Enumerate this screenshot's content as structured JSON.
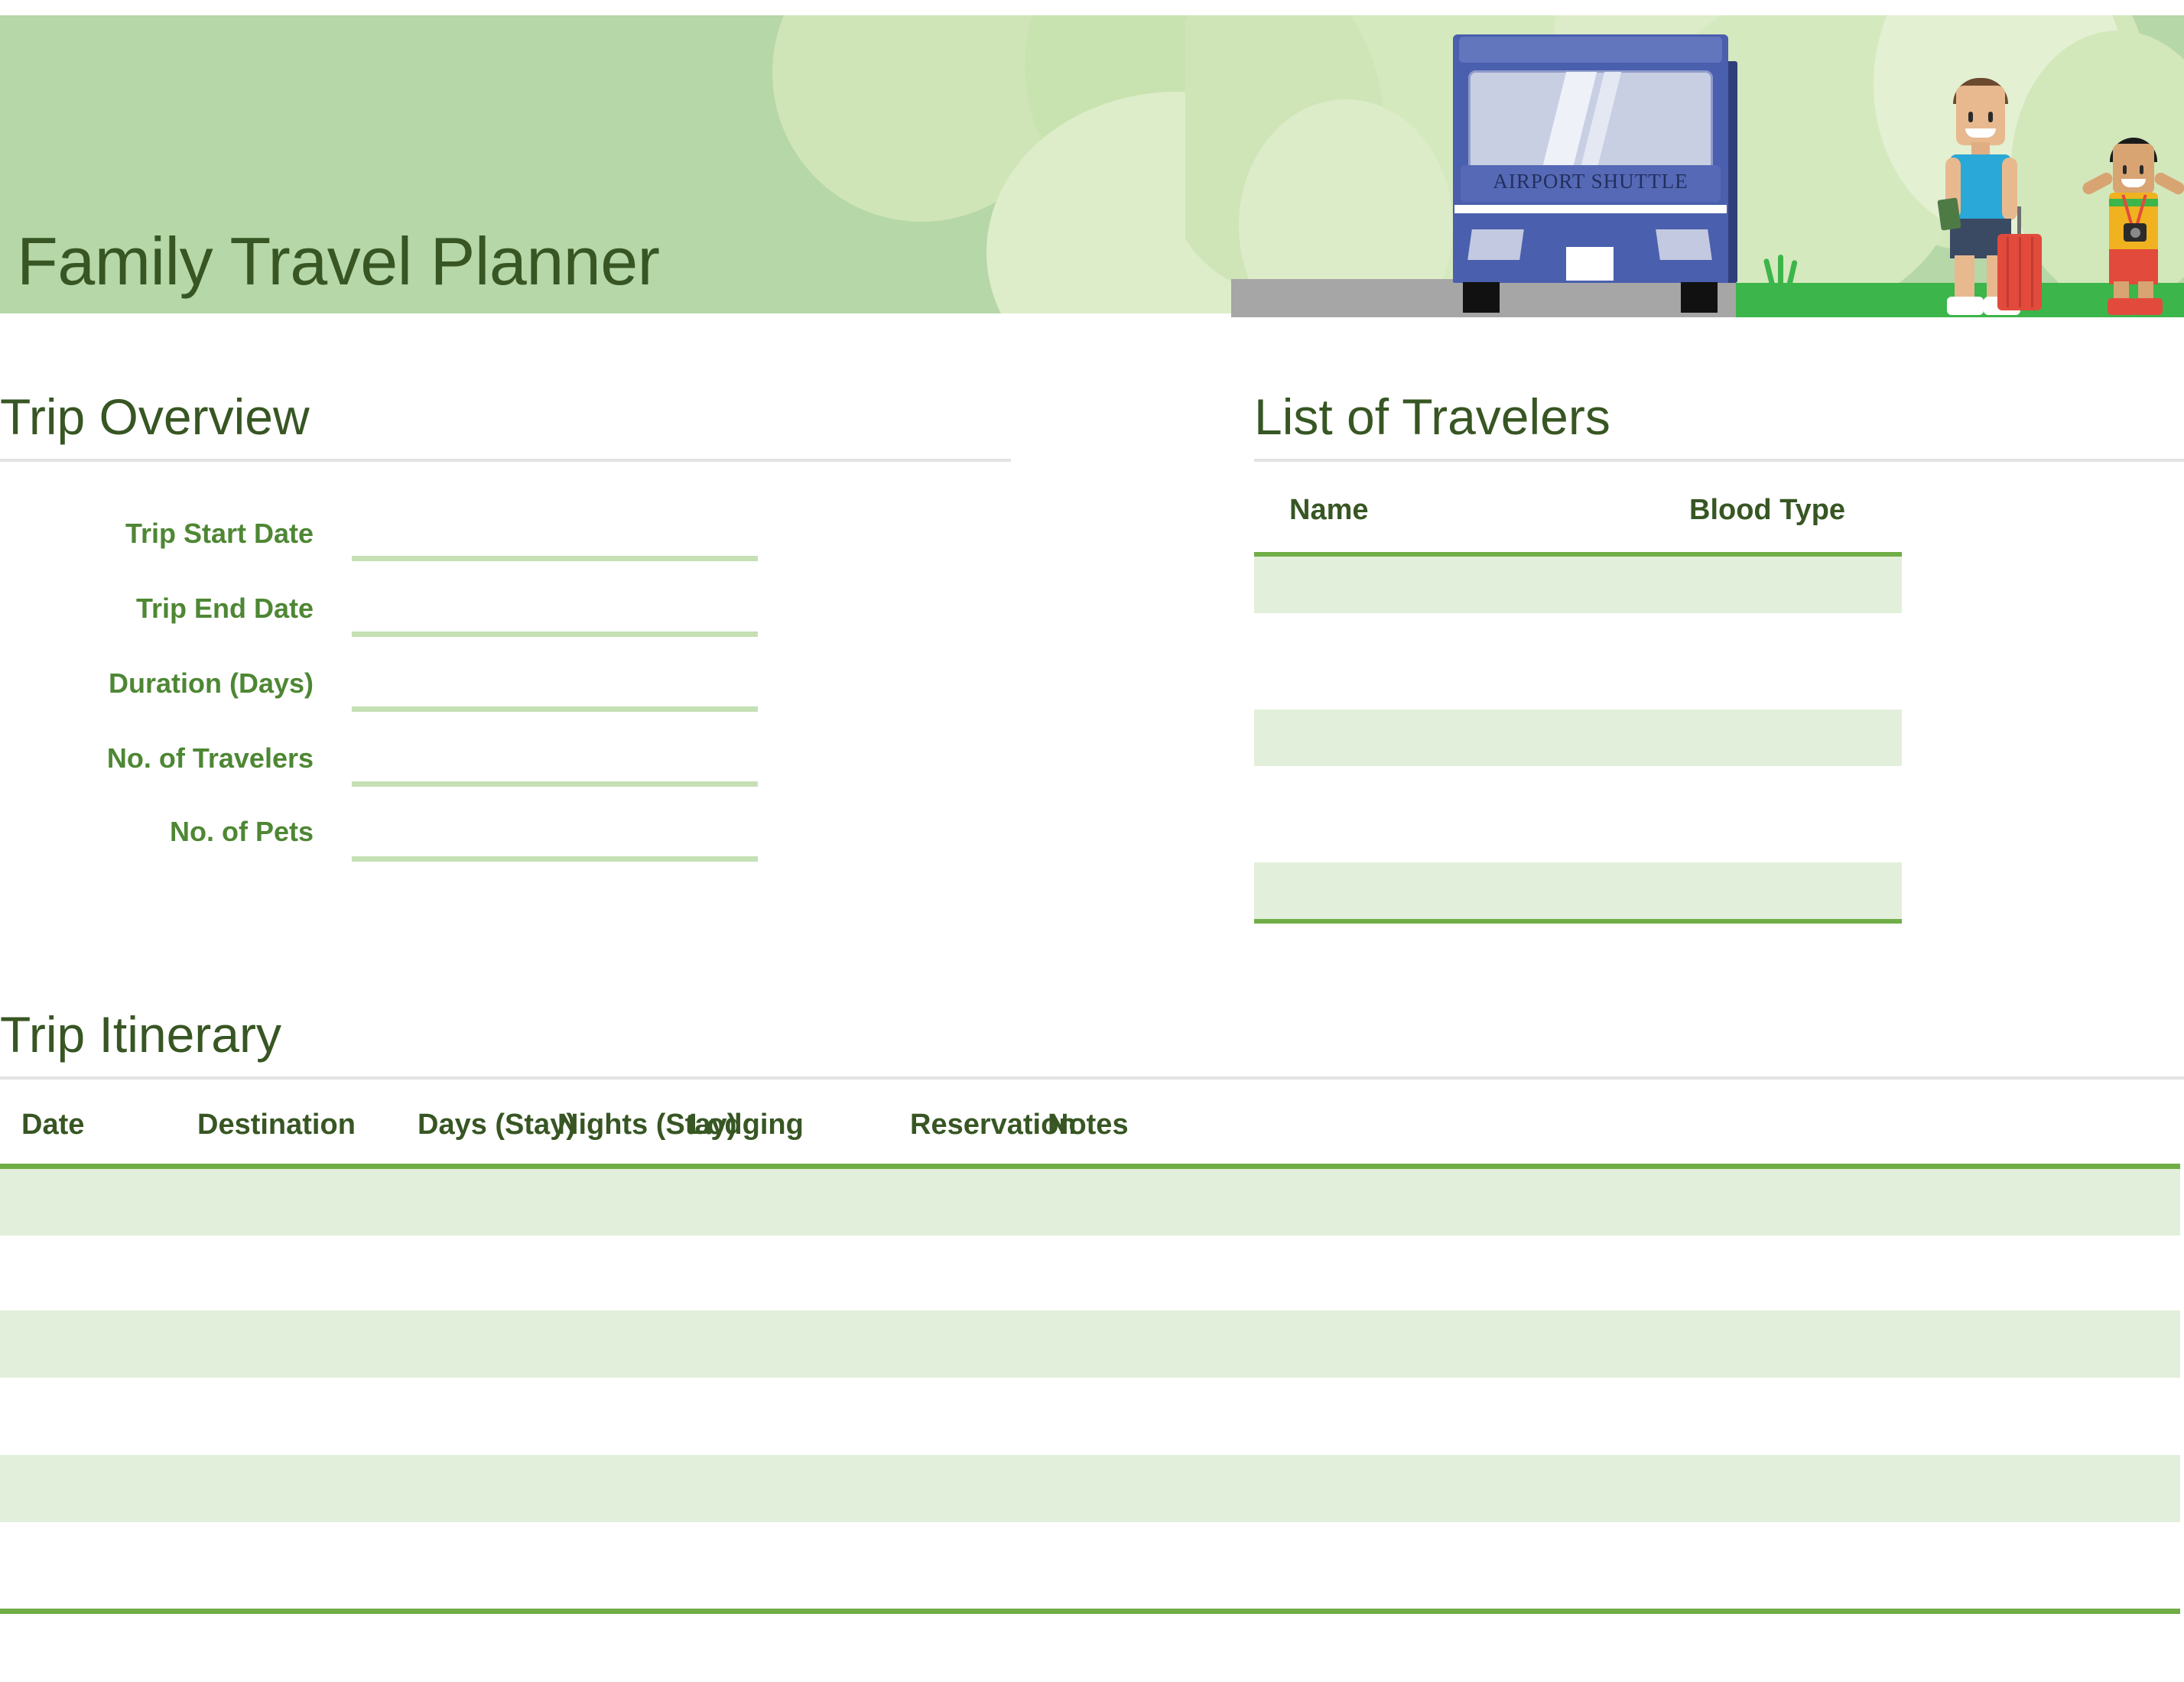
{
  "document": {
    "title": "Family Travel Planner"
  },
  "banner": {
    "title": "Family Travel Planner",
    "illustration": {
      "name": "airport-shuttle-family-illustration",
      "bus_label": "AIRPORT SHUTTLE"
    },
    "colors": {
      "band": "#b6d7a8",
      "title_text": "#375623",
      "bubble_light": "#cfe5b8",
      "bubble_lighter": "#dcecc8"
    }
  },
  "trip_overview": {
    "heading": "Trip Overview",
    "fields": [
      {
        "label": "Trip Start Date",
        "value": ""
      },
      {
        "label": "Trip End Date",
        "value": ""
      },
      {
        "label": "Duration (Days)",
        "value": ""
      },
      {
        "label": "No. of Travelers",
        "value": ""
      },
      {
        "label": "No. of Pets",
        "value": ""
      }
    ]
  },
  "travelers": {
    "heading": "List of Travelers",
    "columns": [
      "Name",
      "Blood Type"
    ],
    "rows": [
      {
        "name": "",
        "blood_type": ""
      },
      {
        "name": "",
        "blood_type": ""
      },
      {
        "name": "",
        "blood_type": ""
      }
    ]
  },
  "itinerary": {
    "heading": "Trip Itinerary",
    "columns": [
      "Date",
      "Destination",
      "Days (Stay)",
      "Nights (Stay)",
      "Lodging",
      "Reservation",
      "Notes"
    ],
    "rows": [
      {
        "date": "",
        "destination": "",
        "days_stay": "",
        "nights_stay": "",
        "lodging": "",
        "reservation": "",
        "notes": ""
      },
      {
        "date": "",
        "destination": "",
        "days_stay": "",
        "nights_stay": "",
        "lodging": "",
        "reservation": "",
        "notes": ""
      },
      {
        "date": "",
        "destination": "",
        "days_stay": "",
        "nights_stay": "",
        "lodging": "",
        "reservation": "",
        "notes": ""
      },
      {
        "date": "",
        "destination": "",
        "days_stay": "",
        "nights_stay": "",
        "lodging": "",
        "reservation": "",
        "notes": ""
      },
      {
        "date": "",
        "destination": "",
        "days_stay": "",
        "nights_stay": "",
        "lodging": "",
        "reservation": "",
        "notes": ""
      },
      {
        "date": "",
        "destination": "",
        "days_stay": "",
        "nights_stay": "",
        "lodging": "",
        "reservation": "",
        "notes": ""
      }
    ]
  },
  "theme": {
    "accent_green": "#70ad47",
    "dark_green": "#375623",
    "label_green": "#4e8734",
    "band_green": "#e2efda",
    "line_green": "#c5e0b4",
    "rule_gray": "#e3e3e3"
  }
}
